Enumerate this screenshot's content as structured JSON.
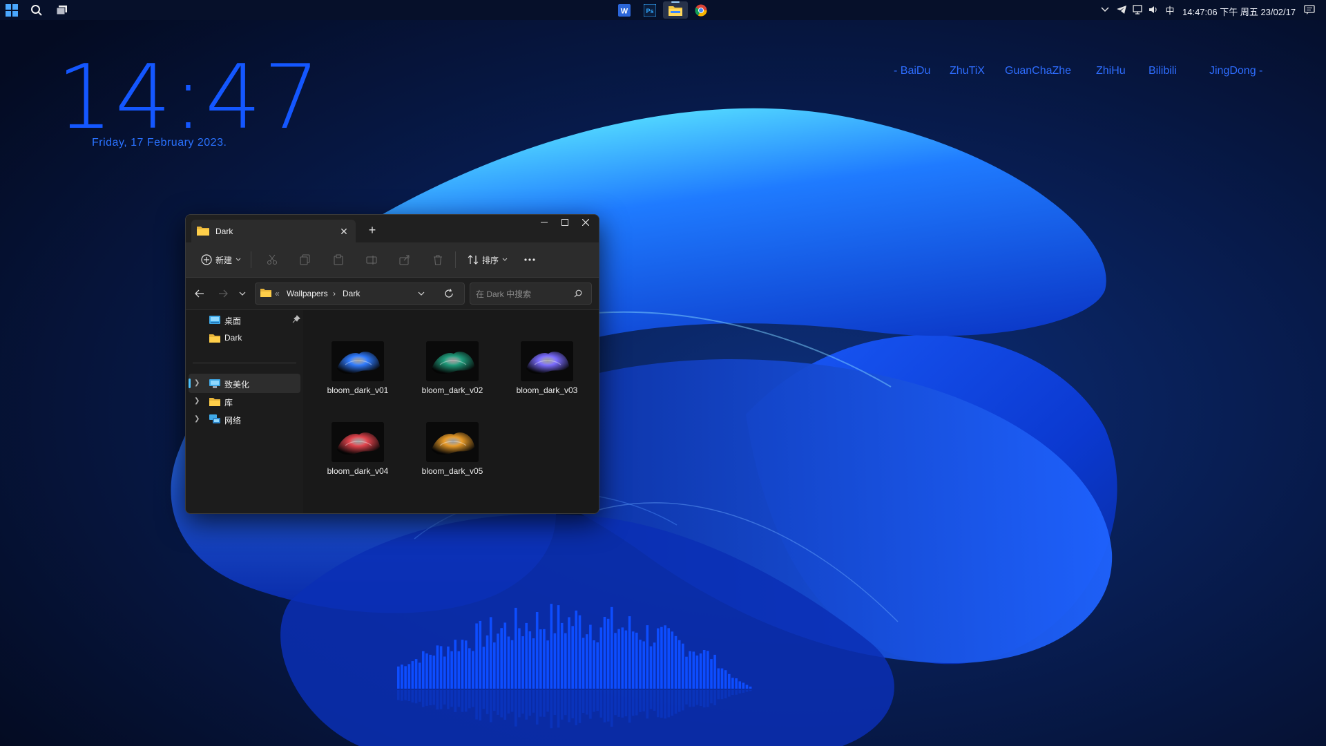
{
  "desktop": {
    "clock_time": "14:47",
    "clock_date": "Friday, 17 February 2023.",
    "links": [
      "- BaiDu",
      "ZhuTiX",
      "GuanChaZhe",
      "ZhiHu",
      "Bilibili",
      "JingDong -"
    ]
  },
  "taskbar": {
    "start_icon": "windows-logo-icon",
    "search_icon": "search-icon",
    "taskview_icon": "task-view-icon",
    "apps": [
      {
        "name": "Word",
        "icon": "word-icon",
        "glyph": "W",
        "active": false
      },
      {
        "name": "Photoshop",
        "icon": "photoshop-icon",
        "glyph": "Ps",
        "active": false
      },
      {
        "name": "File Explorer",
        "icon": "file-explorer-icon",
        "glyph": "",
        "active": true
      },
      {
        "name": "Chrome",
        "icon": "chrome-icon",
        "glyph": "",
        "active": false
      }
    ],
    "tray": {
      "ime": "中",
      "clock": "14:47:06 下午 周五 23/02/17"
    }
  },
  "explorer": {
    "tab_title": "Dark",
    "toolbar": {
      "new_label": "新建",
      "sort_label": "排序"
    },
    "address": {
      "overflow": "«",
      "crumbs": [
        "Wallpapers",
        "Dark"
      ],
      "separator": "›"
    },
    "search": {
      "placeholder": "在 Dark 中搜索"
    },
    "nav": {
      "pinned": [
        {
          "label": "桌面",
          "icon": "desktop-icon",
          "pinned": true
        },
        {
          "label": "Dark",
          "icon": "folder-icon",
          "pinned": false
        }
      ],
      "tree": [
        {
          "label": "致美化",
          "icon": "computer-icon",
          "selected": true
        },
        {
          "label": "库",
          "icon": "library-folder-icon",
          "selected": false
        },
        {
          "label": "网络",
          "icon": "network-icon",
          "selected": false
        }
      ]
    },
    "files": [
      {
        "name": "bloom_dark_v01",
        "color": "#2f7bff"
      },
      {
        "name": "bloom_dark_v02",
        "color": "#1f9a7a"
      },
      {
        "name": "bloom_dark_v03",
        "color": "#7a6cff"
      },
      {
        "name": "bloom_dark_v04",
        "color": "#e2444d"
      },
      {
        "name": "bloom_dark_v05",
        "color": "#e79a28"
      }
    ]
  },
  "colors": {
    "accent_blue": "#1457ff",
    "link_blue": "#2e6dff",
    "visualizer_blue": "#0d4dff",
    "selection_accent": "#4cc2ff"
  }
}
